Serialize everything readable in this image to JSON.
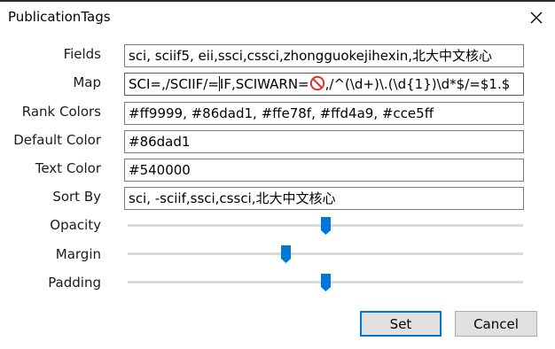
{
  "window": {
    "title": "PublicationTags"
  },
  "form": {
    "fields": {
      "label": "Fields",
      "value": "sci, sciif5, eii,ssci,cssci,zhongguokejihexin,北大中文核心"
    },
    "map": {
      "label": "Map",
      "value_before_caret": "SCI=,/SCIIF/=",
      "value_after_caret": "IF,SCIWARN=",
      "value_after_icon": ",/^(\\d+)\\.(\\d{1})\\d*$/=$1.$"
    },
    "rank_colors": {
      "label": "Rank Colors",
      "value": "#ff9999, #86dad1, #ffe78f, #ffd4a9, #cce5ff"
    },
    "default_color": {
      "label": "Default Color",
      "value": "#86dad1"
    },
    "text_color": {
      "label": "Text Color",
      "value": "#540000"
    },
    "sort_by": {
      "label": "Sort By",
      "value": "sci, -sciif,ssci,cssci,北大中文核心"
    },
    "opacity": {
      "label": "Opacity",
      "level": 0.5
    },
    "margin": {
      "label": "Margin",
      "level": 0.4
    },
    "padding": {
      "label": "Padding",
      "level": 0.5
    }
  },
  "buttons": {
    "set": "Set",
    "cancel": "Cancel"
  },
  "colors": {
    "accent": "#0078d7",
    "no_entry": "#e0322f"
  }
}
